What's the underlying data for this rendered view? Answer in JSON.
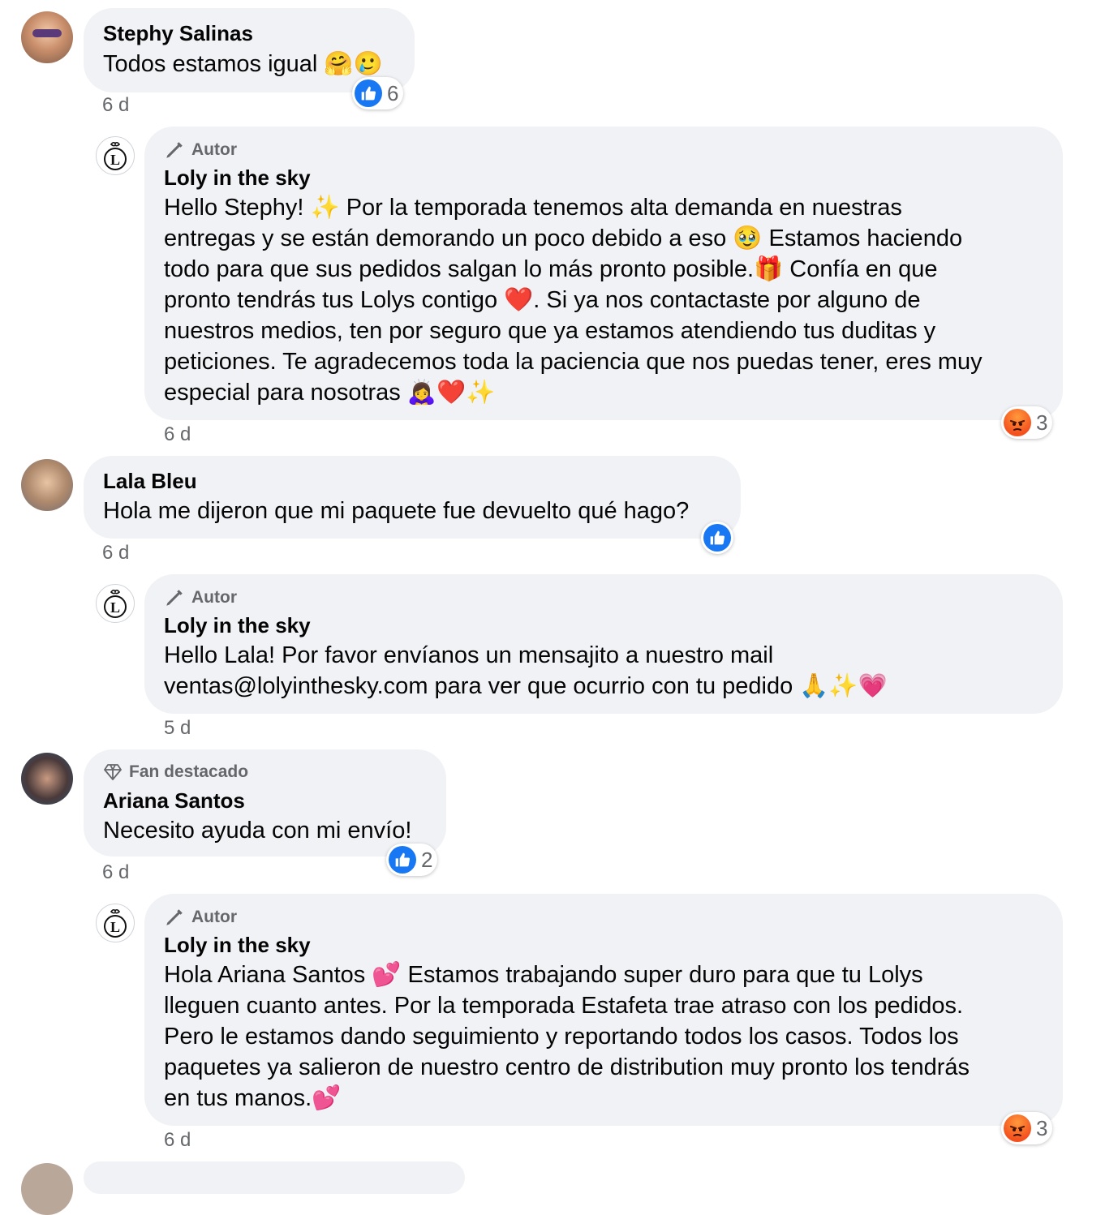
{
  "comments": [
    {
      "name": "Stephy Salinas",
      "lines": [
        "Todos estamos igual 🤗🥲"
      ],
      "time": "6 d",
      "reaction": {
        "type": "like",
        "count": "6"
      }
    },
    {
      "badge": "Autor",
      "name": "Loly in the sky",
      "lines": [
        "Hello Stephy! ✨ Por la temporada tenemos alta demanda en nuestras",
        "entregas y se están demorando un poco debido a eso 🥹 Estamos haciendo",
        "todo para que sus pedidos salgan lo más pronto posible.🎁 Confía en que",
        "pronto tendrás tus Lolys contigo ❤️. Si ya nos contactaste por alguno de",
        "nuestros medios, ten por seguro que ya estamos atendiendo tus duditas y",
        "peticiones. Te agradecemos toda la paciencia que nos puedas tener, eres muy",
        "especial para nosotras 🙇‍♀️❤️✨"
      ],
      "time": "6 d",
      "reaction": {
        "type": "angry",
        "count": "3"
      }
    },
    {
      "name": "Lala Bleu",
      "lines": [
        "Hola me dijeron que mi paquete fue devuelto qué hago?"
      ],
      "time": "6 d",
      "reaction": {
        "type": "like",
        "count": ""
      }
    },
    {
      "badge": "Autor",
      "name": "Loly in the sky",
      "lines": [
        "Hello Lala! Por favor envíanos un mensajito a nuestro mail",
        "ventas@lolyinthesky.com para ver que ocurrio con tu pedido 🙏✨💗"
      ],
      "time": "5 d"
    },
    {
      "badge": "Fan destacado",
      "name": "Ariana Santos",
      "lines": [
        "Necesito ayuda con mi envío!"
      ],
      "time": "6 d",
      "reaction": {
        "type": "like",
        "count": "2"
      }
    },
    {
      "badge": "Autor",
      "name": "Loly in the sky",
      "lines": [
        "Hola Ariana Santos 💕 Estamos trabajando super duro para que tu Lolys",
        "lleguen cuanto antes. Por la temporada Estafeta trae atraso con los pedidos.",
        "Pero le estamos dando seguimiento y reportando todos los casos. Todos los",
        "paquetes ya salieron de nuestro centro de distribution muy pronto los tendrás",
        "en tus manos.💕"
      ],
      "time": "6 d",
      "reaction": {
        "type": "angry",
        "count": "3"
      }
    }
  ]
}
